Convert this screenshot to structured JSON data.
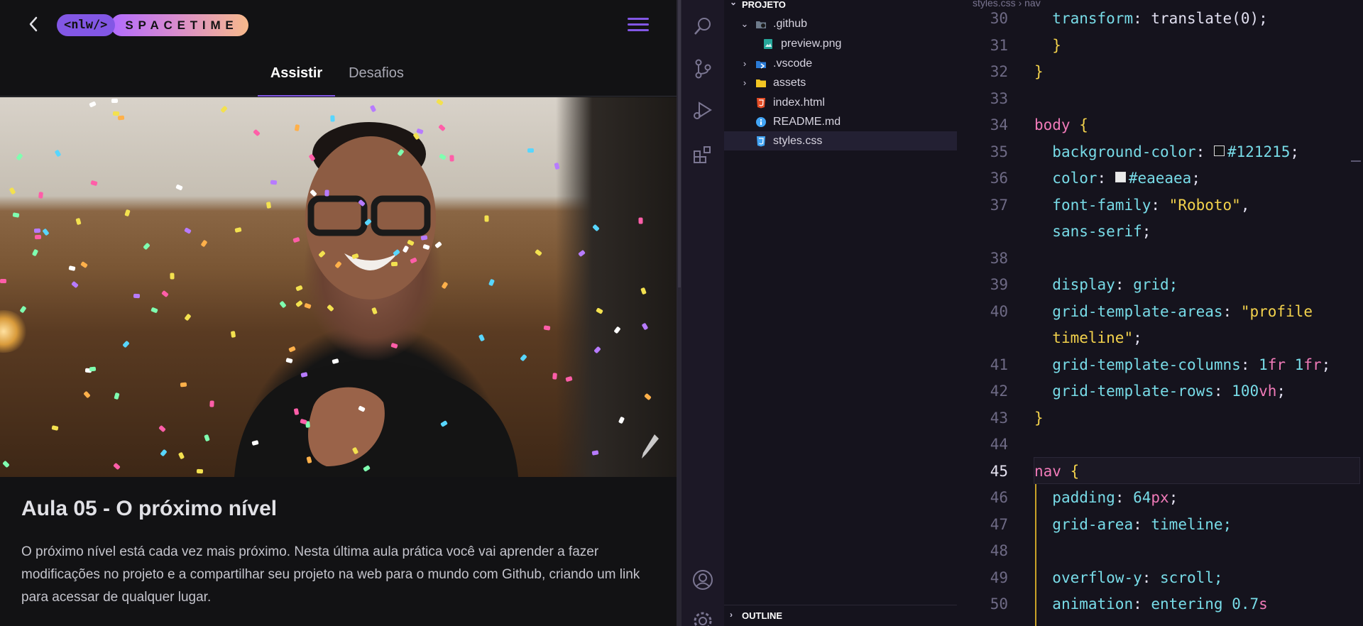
{
  "player": {
    "logo_tag": "<nlw/>",
    "logo_word": "SPACETIME",
    "tabs": [
      {
        "label": "Assistir",
        "active": true
      },
      {
        "label": "Desafios",
        "active": false
      }
    ],
    "lesson_title": "Aula 05 - O próximo nível",
    "lesson_description": "O próximo nível está cada vez mais próximo. Nesta última aula prática você vai aprender a fazer modificações no projeto e a compartilhar seu projeto na web para o mundo com Github, criando um link para acessar de qualquer lugar.",
    "accent_color": "#8257e5"
  },
  "explorer": {
    "section_title": "PROJETO",
    "items": [
      {
        "label": ".github",
        "type": "folder",
        "expanded": true
      },
      {
        "label": "preview.png",
        "type": "image"
      },
      {
        "label": ".vscode",
        "type": "folder",
        "expanded": false
      },
      {
        "label": "assets",
        "type": "folder",
        "expanded": false
      },
      {
        "label": "index.html",
        "type": "html"
      },
      {
        "label": "README.md",
        "type": "info"
      },
      {
        "label": "styles.css",
        "type": "css",
        "selected": true
      }
    ],
    "outline_title": "OUTLINE"
  },
  "editor": {
    "breadcrumb": {
      "file": "styles.css",
      "symbol": "nav"
    },
    "active_line": "45",
    "line_numbers": [
      "30",
      "31",
      "32",
      "33",
      "34",
      "35",
      "36",
      "37",
      "",
      "38",
      "39",
      "40",
      "",
      "41",
      "42",
      "43",
      "44",
      "45",
      "46",
      "47",
      "48",
      "49",
      "50"
    ],
    "lines": [
      {
        "prop": "transform",
        "val": "translate(0);"
      },
      {
        "text": "}"
      },
      {
        "text": "}"
      },
      {
        "text": ""
      },
      {
        "selector": "body",
        "brace": "{"
      },
      {
        "prop": "background-color",
        "hex": "#121215"
      },
      {
        "prop": "color",
        "hex": "#eaeaea"
      },
      {
        "prop": "font-family",
        "str": "\"Roboto\"",
        "after": ","
      },
      {
        "plain": "sans-serif",
        "after": ";"
      },
      {
        "text": ""
      },
      {
        "prop": "display",
        "plain": "grid;"
      },
      {
        "prop": "grid-template-areas",
        "str": "\"profile"
      },
      {
        "str": "timeline\"",
        "after": ";"
      },
      {
        "prop": "grid-template-columns",
        "parts": [
          "1fr",
          "1fr"
        ]
      },
      {
        "prop": "grid-template-rows",
        "num": "100",
        "unit": "vh"
      },
      {
        "text": "}"
      },
      {
        "text": ""
      },
      {
        "selector": "nav",
        "brace": "{"
      },
      {
        "prop": "padding",
        "num": "64",
        "unit": "px"
      },
      {
        "prop": "grid-area",
        "plain": "timeline;"
      },
      {
        "text": ""
      },
      {
        "prop": "overflow-y",
        "plain": "scroll;"
      },
      {
        "prop": "animation",
        "plain": "entering",
        "num": "0.7",
        "unit": "s"
      }
    ]
  }
}
